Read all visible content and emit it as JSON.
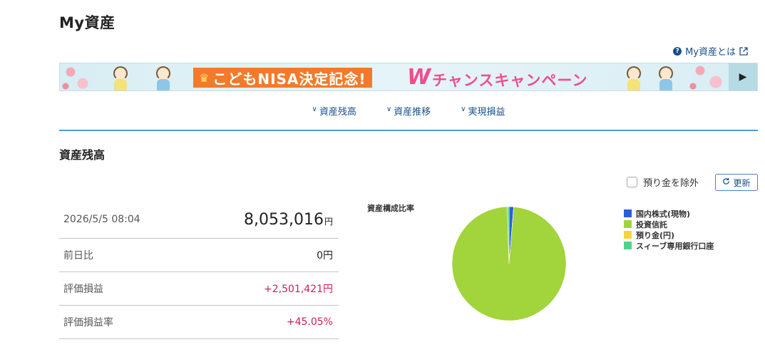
{
  "page": {
    "title": "My資産"
  },
  "help": {
    "label": "My資産とは"
  },
  "banner": {
    "tag": "こどもNISA決定記念!",
    "w_letter": "W",
    "campaign": "チャンスキャンペーン"
  },
  "anchors": [
    {
      "label": "資産残高"
    },
    {
      "label": "資産推移"
    },
    {
      "label": "実現損益"
    }
  ],
  "section": {
    "title": "資産残高"
  },
  "controls": {
    "exclude_label": "預り金を除外",
    "refresh_label": "更新"
  },
  "summary": {
    "datetime": "2026/5/5 08:04",
    "total_value": "8,053,016",
    "total_unit": "円",
    "rows": [
      {
        "label": "前日比",
        "value": "0円"
      },
      {
        "label": "評価損益",
        "value": "+2,501,421円"
      },
      {
        "label": "評価損益率",
        "value": "+45.05%"
      }
    ]
  },
  "chart_data": {
    "type": "pie",
    "title": "資産構成比率",
    "categories": [
      "国内株式(現物)",
      "投資信託",
      "預り金(円)",
      "スィーブ専用銀行口座"
    ],
    "values": [
      1.3,
      98.2,
      0.0,
      0.5
    ],
    "colors": [
      "#2b5ed9",
      "#a2d43b",
      "#f5d53b",
      "#4cd48c"
    ],
    "legend_position": "right"
  }
}
